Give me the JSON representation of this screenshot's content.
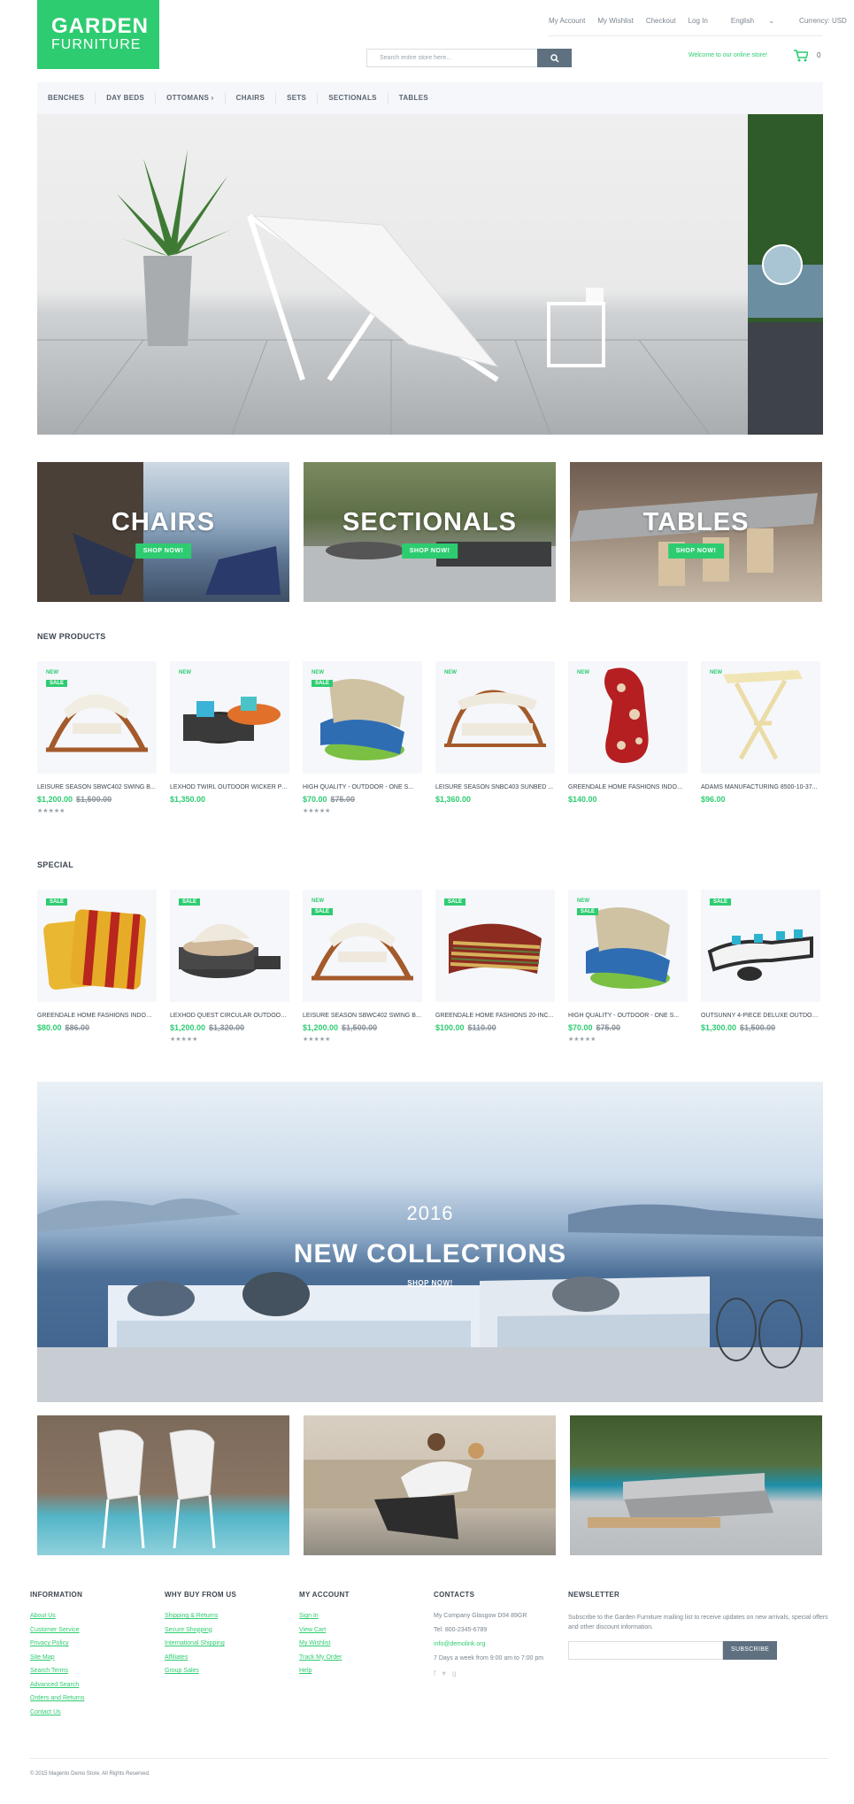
{
  "logo": {
    "line1": "GARDEN",
    "line2": "FURNITURE"
  },
  "top_links": [
    "My Account",
    "My Wishlist",
    "Checkout",
    "Log In"
  ],
  "language": "English",
  "currency": "Currency: USD",
  "search": {
    "placeholder": "Search entire store here..."
  },
  "welcome": "Welcome to our online store!",
  "cart_count": "0",
  "nav": [
    "BENCHES",
    "DAY BEDS",
    "OTTOMANS",
    "CHAIRS",
    "SETS",
    "SECTIONALS",
    "TABLES"
  ],
  "categories": [
    {
      "title": "CHAIRS",
      "button": "SHOP NOW!"
    },
    {
      "title": "SECTIONALS",
      "button": "SHOP NOW!"
    },
    {
      "title": "TABLES",
      "button": "SHOP NOW!"
    }
  ],
  "new_products": {
    "title": "NEW PRODUCTS",
    "items": [
      {
        "name": "LEISURE SEASON SBWC402 SWING B...",
        "price": "$1,200.00",
        "old": "$1,500.00",
        "badges": [
          "NEW",
          "SALE"
        ],
        "stars": "★★★★★"
      },
      {
        "name": "LEXHOD TWIRL OUTDOOR WICKER PA...",
        "price": "$1,350.00",
        "old": "",
        "badges": [
          "NEW"
        ],
        "stars": ""
      },
      {
        "name": "HIGH QUALITY - OUTDOOR - ONE S...",
        "price": "$70.00",
        "old": "$75.00",
        "badges": [
          "NEW",
          "SALE"
        ],
        "stars": "★★★★★"
      },
      {
        "name": "LEISURE SEASON SNBC403 SUNBED ...",
        "price": "$1,360.00",
        "old": "",
        "badges": [
          "NEW"
        ],
        "stars": ""
      },
      {
        "name": "GREENDALE HOME FASHIONS INDOOR...",
        "price": "$140.00",
        "old": "",
        "badges": [
          "NEW"
        ],
        "stars": ""
      },
      {
        "name": "ADAMS MANUFACTURING 8500-10-37...",
        "price": "$96.00",
        "old": "",
        "badges": [
          "NEW"
        ],
        "stars": ""
      }
    ]
  },
  "special": {
    "title": "SPECIAL",
    "items": [
      {
        "name": "GREENDALE HOME FASHIONS INDOOR...",
        "price": "$80.00",
        "old": "$86.00",
        "badges": [
          "SALE"
        ],
        "stars": ""
      },
      {
        "name": "LEXHOD QUEST CIRCULAR OUTDOOR ...",
        "price": "$1,200.00",
        "old": "$1,320.00",
        "badges": [
          "SALE"
        ],
        "stars": "★★★★★"
      },
      {
        "name": "LEISURE SEASON SBWC402 SWING B...",
        "price": "$1,200.00",
        "old": "$1,500.00",
        "badges": [
          "NEW",
          "SALE"
        ],
        "stars": "★★★★★"
      },
      {
        "name": "GREENDALE HOME FASHIONS 20-INC...",
        "price": "$100.00",
        "old": "$110.00",
        "badges": [
          "SALE"
        ],
        "stars": ""
      },
      {
        "name": "HIGH QUALITY - OUTDOOR - ONE S...",
        "price": "$70.00",
        "old": "$75.00",
        "badges": [
          "NEW",
          "SALE"
        ],
        "stars": "★★★★★"
      },
      {
        "name": "OUTSUNNY 4-PIECE DELUXE OUTDOO...",
        "price": "$1,300.00",
        "old": "$1,500.00",
        "badges": [
          "SALE"
        ],
        "stars": ""
      }
    ]
  },
  "collection": {
    "year": "2016",
    "headline": "NEW COLLECTIONS",
    "button": "SHOP NOW!"
  },
  "footer": {
    "information": {
      "title": "INFORMATION",
      "links": [
        "About Us",
        "Customer Service",
        "Privacy Policy",
        "Site Map",
        "Search Terms",
        "Advanced Search",
        "Orders and Returns",
        "Contact Us"
      ]
    },
    "why_buy": {
      "title": "WHY BUY FROM US",
      "links": [
        "Shipping & Returns",
        "Secure Shopping",
        "International Shipping",
        "Affiliates",
        "Group Sales"
      ]
    },
    "my_account": {
      "title": "MY ACCOUNT",
      "links": [
        "Sign In",
        "View Cart",
        "My Wishlist",
        "Track My Order",
        "Help"
      ]
    },
    "contacts": {
      "title": "CONTACTS",
      "address": "My Company Glasgow D04 89GR",
      "tel": "Tel: 800-2345-6789",
      "email": "info@demolink.org",
      "hours": "7 Days a week from 9:00 am to 7:00 pm"
    },
    "newsletter": {
      "title": "NEWSLETTER",
      "text": "Subscribe to the Garden Furniture mailing list to receive updates on new arrivals, special offers and other discount information.",
      "button": "SUBSCRIBE"
    }
  },
  "copyright": "© 2015 Magento Demo Store. All Rights Reserved.",
  "colors": {
    "accent": "#2ecc71",
    "dark_button": "#5f7180",
    "panel_bg": "#f5f7fb"
  }
}
